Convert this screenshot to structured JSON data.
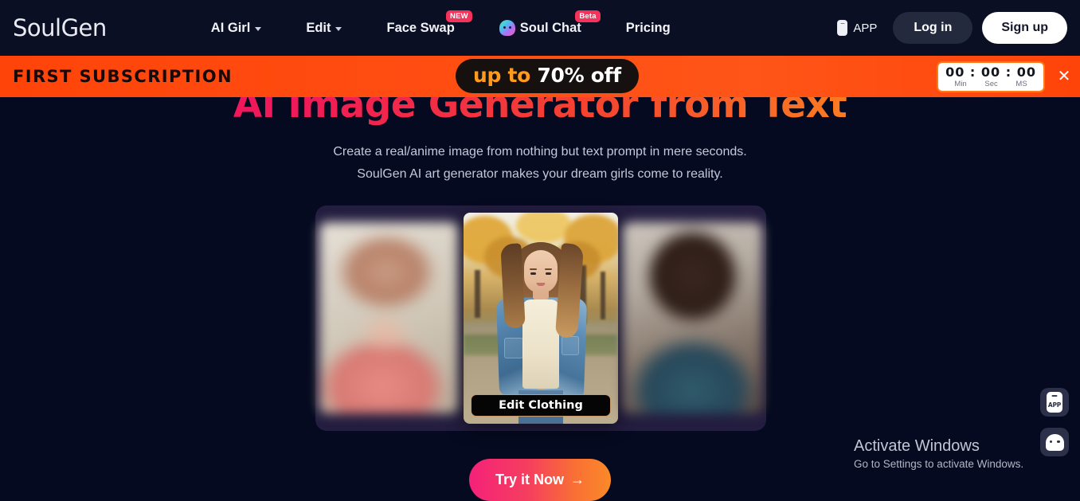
{
  "site": {
    "background_color": "#050a20",
    "logo": "SoulGen"
  },
  "header": {
    "nav": [
      {
        "label": "AI Girl",
        "icon": "chevron-down-icon",
        "has_caret": true,
        "badge": null
      },
      {
        "label": "Edit",
        "icon": "chevron-down-icon",
        "has_caret": true,
        "badge": null
      },
      {
        "label": "Face Swap",
        "has_caret": false,
        "badge": "NEW"
      },
      {
        "label": "Soul Chat",
        "icon": "ghost-icon",
        "has_caret": false,
        "badge": "Beta"
      },
      {
        "label": "Pricing",
        "has_caret": false,
        "badge": null
      }
    ],
    "app_label": "APP",
    "app_icon": "phone-icon",
    "login_label": "Log in",
    "signup_label": "Sign up",
    "badge_color": "#f5325b"
  },
  "promo_banner": {
    "title": "FIRST SUBSCRIPTION",
    "offer_prefix": "up to ",
    "offer_amount": "70% off",
    "background_color": "#ff4409",
    "offer_prefix_color": "#ff9a1f",
    "timer": {
      "minutes": "00",
      "seconds": "00",
      "ms": "00",
      "separator": ":",
      "label_minutes": "Min",
      "label_seconds": "Sec",
      "label_ms": "MS"
    },
    "close_icon": "close-icon",
    "close_glyph": "✕"
  },
  "hero": {
    "title": "AI Image Generator from Text",
    "title_gradient_start": "#ec1060",
    "title_gradient_end": "#fca61f",
    "subtitle_line1": "Create a real/anime image from nothing but text prompt in mere seconds.",
    "subtitle_line2": "SoulGen AI art generator makes your dream girls come to reality."
  },
  "carousel": {
    "background_color": "#231d3f",
    "cards": [
      {
        "position": "left",
        "focus": "blurred",
        "alt": "blurred portrait of woman in pink top"
      },
      {
        "position": "center",
        "focus": "sharp",
        "alt": "woman in denim jacket in autumn park",
        "overlay_button": "Edit Clothing"
      },
      {
        "position": "right",
        "focus": "blurred",
        "alt": "blurred portrait of woman in teal top"
      }
    ]
  },
  "cta": {
    "label": "Try it Now",
    "arrow_icon": "arrow-right-icon",
    "arrow_glyph": "→",
    "gradient_start": "#f5217a",
    "gradient_end": "#fb8a28"
  },
  "floating_buttons": [
    {
      "name": "app-download",
      "icon": "phone-app-icon",
      "label": "APP"
    },
    {
      "name": "soul-chat",
      "icon": "ghost-chat-icon",
      "label": ""
    }
  ],
  "watermark": {
    "title": "Activate Windows",
    "subtitle": "Go to Settings to activate Windows."
  }
}
